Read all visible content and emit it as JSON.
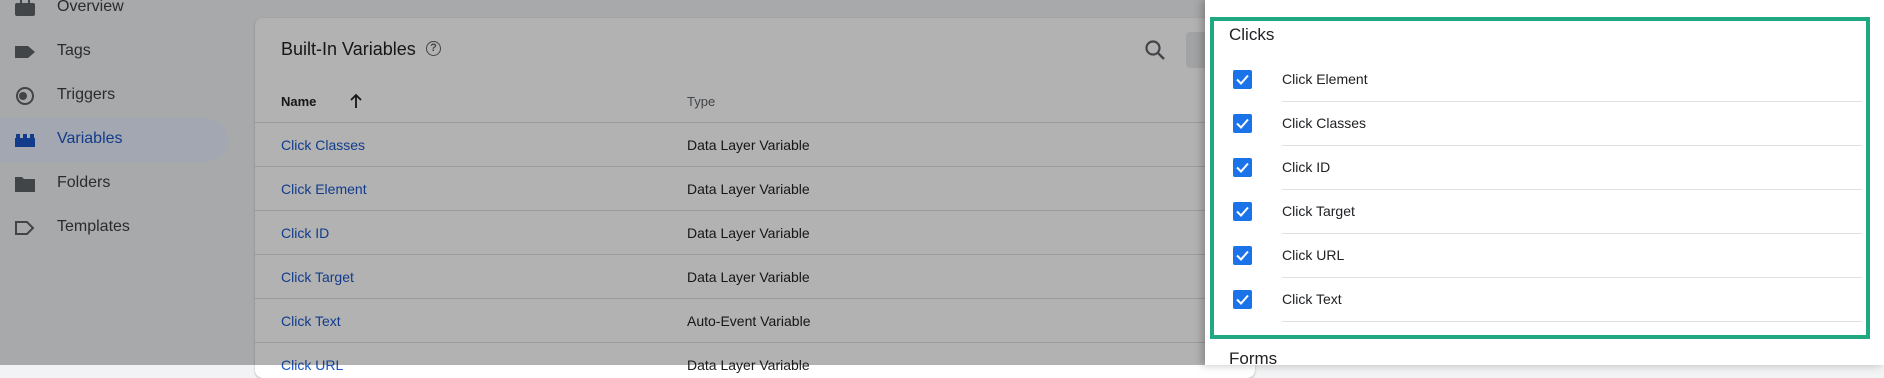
{
  "sidebar": {
    "items": [
      {
        "label": "Overview",
        "icon": "briefcase-icon"
      },
      {
        "label": "Tags",
        "icon": "tag-icon"
      },
      {
        "label": "Triggers",
        "icon": "trigger-icon"
      },
      {
        "label": "Variables",
        "icon": "variables-icon",
        "active": true
      },
      {
        "label": "Folders",
        "icon": "folder-icon"
      },
      {
        "label": "Templates",
        "icon": "template-icon"
      }
    ]
  },
  "main": {
    "title": "Built-In Variables",
    "columns": {
      "name": "Name",
      "type": "Type"
    },
    "rows": [
      {
        "name": "Click Classes",
        "type": "Data Layer Variable"
      },
      {
        "name": "Click Element",
        "type": "Data Layer Variable"
      },
      {
        "name": "Click ID",
        "type": "Data Layer Variable"
      },
      {
        "name": "Click Target",
        "type": "Data Layer Variable"
      },
      {
        "name": "Click Text",
        "type": "Auto-Event Variable"
      },
      {
        "name": "Click URL",
        "type": "Data Layer Variable"
      }
    ]
  },
  "panel": {
    "section_title": "Clicks",
    "options": [
      {
        "label": "Click Element",
        "checked": true
      },
      {
        "label": "Click Classes",
        "checked": true
      },
      {
        "label": "Click ID",
        "checked": true
      },
      {
        "label": "Click Target",
        "checked": true
      },
      {
        "label": "Click URL",
        "checked": true
      },
      {
        "label": "Click Text",
        "checked": true
      }
    ],
    "next_section_title": "Forms"
  },
  "colors": {
    "accent": "#1a73e8",
    "link": "#1a56c8",
    "highlight_border": "#1fa882"
  }
}
